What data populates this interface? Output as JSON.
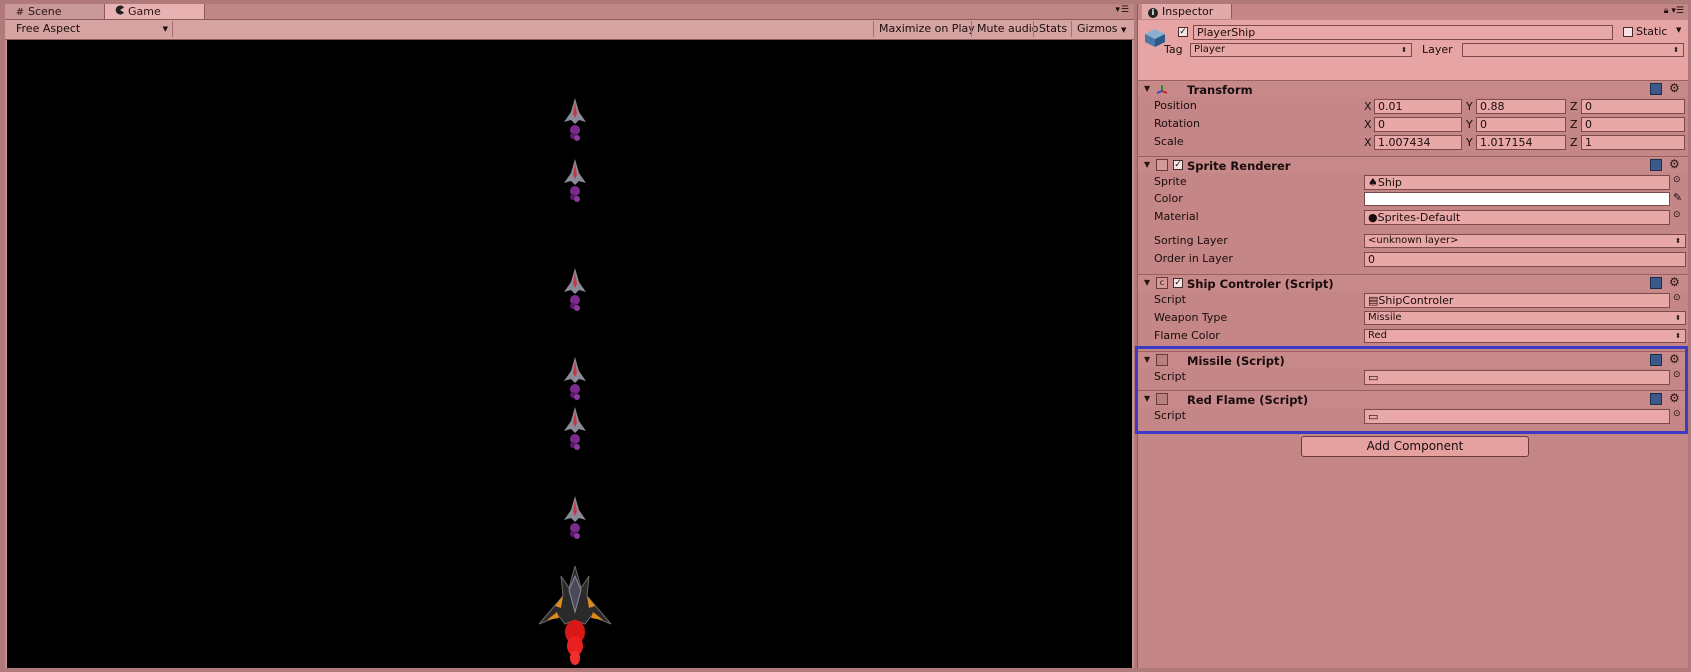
{
  "tabs": {
    "scene": "Scene",
    "game": "Game"
  },
  "toolbar": {
    "aspect": "Free Aspect",
    "maximize": "Maximize on Play",
    "mute": "Mute audio",
    "stats": "Stats",
    "gizmos": "Gizmos"
  },
  "inspector": {
    "tab": "Inspector",
    "object_name": "PlayerShip",
    "static_label": "Static",
    "tag_label": "Tag",
    "tag_value": "Player",
    "layer_label": "Layer",
    "layer_value": ""
  },
  "transform": {
    "title": "Transform",
    "position_label": "Position",
    "rotation_label": "Rotation",
    "scale_label": "Scale",
    "axis_x": "X",
    "axis_y": "Y",
    "axis_z": "Z",
    "position": {
      "x": "0.01",
      "y": "0.88",
      "z": "0"
    },
    "rotation": {
      "x": "0",
      "y": "0",
      "z": "0"
    },
    "scale": {
      "x": "1.007434",
      "y": "1.017154",
      "z": "1"
    }
  },
  "sprite_renderer": {
    "title": "Sprite Renderer",
    "sprite_label": "Sprite",
    "sprite_value": "Ship",
    "color_label": "Color",
    "color_value": "#ffffff",
    "material_label": "Material",
    "material_value": "Sprites-Default",
    "sorting_layer_label": "Sorting Layer",
    "sorting_layer_value": "<unknown layer>",
    "order_label": "Order in Layer",
    "order_value": "0"
  },
  "ship_controler": {
    "title": "Ship Controler (Script)",
    "script_label": "Script",
    "script_value": "ShipControler",
    "weapon_label": "Weapon Type",
    "weapon_value": "Missile",
    "flame_label": "Flame Color",
    "flame_value": "Red"
  },
  "missile": {
    "title": "Missile (Script)",
    "script_label": "Script",
    "script_value": ""
  },
  "red_flame": {
    "title": "Red Flame (Script)",
    "script_label": "Script",
    "script_value": ""
  },
  "add_component": "Add Component",
  "colors": {
    "panel": "#c48686",
    "header": "#e6a4a4",
    "highlight": "#3b3bc4",
    "game_bg": "#000000"
  },
  "icons": [
    "hash-icon",
    "pacman-icon",
    "info-icon",
    "lock-icon",
    "cube-icon",
    "transform-icon",
    "gear-icon",
    "book-icon"
  ]
}
